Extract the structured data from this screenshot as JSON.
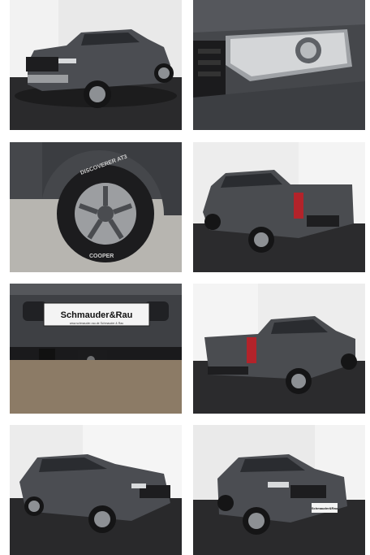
{
  "gallery": {
    "photos": [
      {
        "alt": "Ford Ranger front three-quarter view"
      },
      {
        "alt": "Headlight close-up"
      },
      {
        "alt": "Wheel and tire close-up"
      },
      {
        "alt": "Rear three-quarter view"
      },
      {
        "alt": "Rear bumper with tow hitch"
      },
      {
        "alt": "Rear three-quarter view left"
      },
      {
        "alt": "Front three-quarter view left"
      },
      {
        "alt": "Front three-quarter view right"
      }
    ],
    "tire_text_1": "DISCOVERER AT3",
    "tire_text_2": "COOPER",
    "plate_main": "Schmauder&Rau",
    "plate_sub": "www.schmauder-rau.de   Schmauder & Rau",
    "plate_front": "Schmauder&Rau"
  },
  "colors": {
    "body_gray": "#4a4c50",
    "floor": "#2d2d2f",
    "wall": "#eeeeee"
  }
}
